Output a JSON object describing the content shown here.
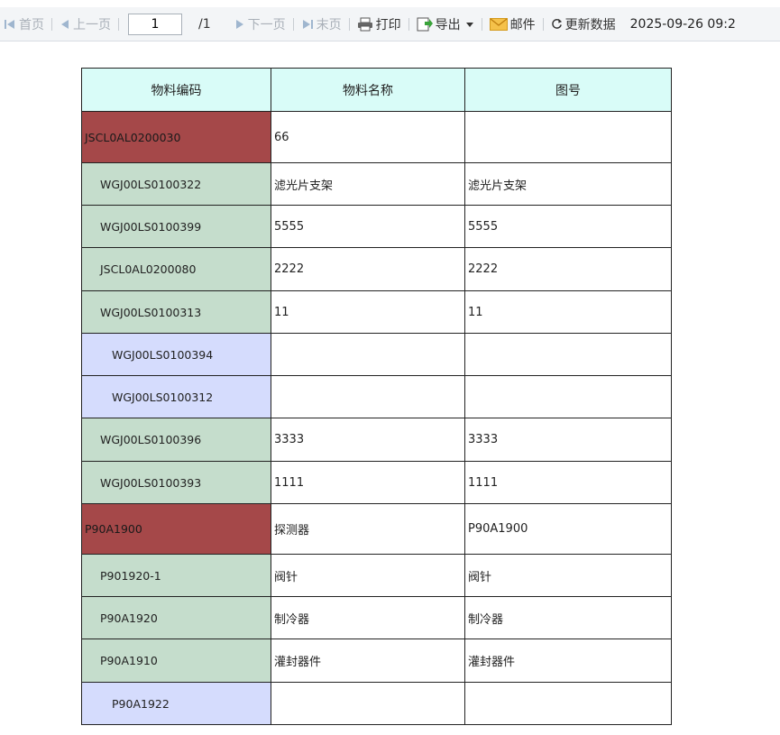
{
  "toolbar": {
    "first": "首页",
    "prev": "上一页",
    "page_value": "1",
    "page_total": "/1",
    "next": "下一页",
    "last": "末页",
    "print": "打印",
    "export": "导出",
    "mail": "邮件",
    "refresh": "更新数据",
    "datetime": "2025-09-26 09:2"
  },
  "table": {
    "headers": [
      "物料编码",
      "物料名称",
      "图号"
    ],
    "rows": [
      {
        "code": "JSCL0AL0200030",
        "name": "66",
        "drawing": ""
      },
      {
        "code": "WGJ00LS0100322",
        "name": "滤光片支架",
        "drawing": "滤光片支架"
      },
      {
        "code": "WGJ00LS0100399",
        "name": "5555",
        "drawing": "5555"
      },
      {
        "code": "JSCL0AL0200080",
        "name": "2222",
        "drawing": "2222"
      },
      {
        "code": "WGJ00LS0100313",
        "name": "11",
        "drawing": "11"
      },
      {
        "code": "WGJ00LS0100394",
        "name": "",
        "drawing": ""
      },
      {
        "code": "WGJ00LS0100312",
        "name": "",
        "drawing": ""
      },
      {
        "code": "WGJ00LS0100396",
        "name": "3333",
        "drawing": "3333"
      },
      {
        "code": "WGJ00LS0100393",
        "name": "1111",
        "drawing": "1111"
      },
      {
        "code": "P90A1900",
        "name": "探测器",
        "drawing": "P90A1900"
      },
      {
        "code": "P901920-1",
        "name": "阀针",
        "drawing": "阀针"
      },
      {
        "code": "P90A1920",
        "name": "制冷器",
        "drawing": "制冷器"
      },
      {
        "code": "P90A1910",
        "name": "灌封器件",
        "drawing": "灌封器件"
      },
      {
        "code": "P90A1922",
        "name": "",
        "drawing": ""
      }
    ]
  },
  "colors": {
    "header_bg": "#d9fcf8",
    "level0_bg": "#a54849",
    "level1_bg": "#c5ddcc",
    "level2_bg": "#d5dcfd"
  }
}
